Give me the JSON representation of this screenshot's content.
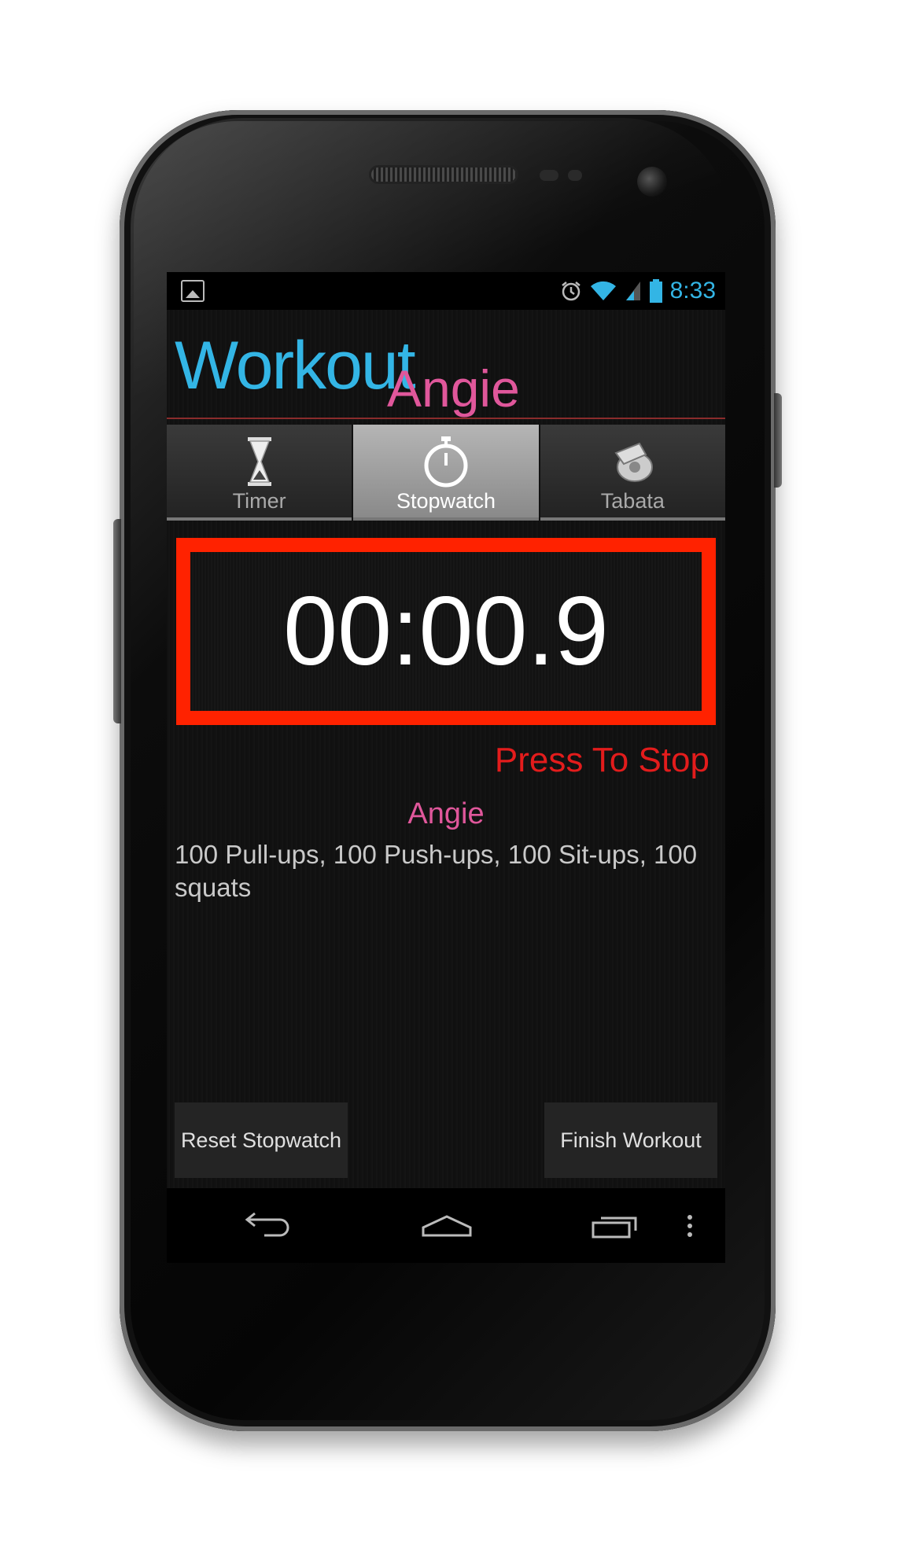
{
  "status_bar": {
    "time": "8:33",
    "left_icon": "picture-icon",
    "icons": [
      "alarm-icon",
      "wifi-icon",
      "signal-icon",
      "battery-icon"
    ]
  },
  "app_title": {
    "main": "Workout",
    "sub": "Angie"
  },
  "tabs": [
    {
      "label": "Timer",
      "icon": "hourglass-icon",
      "active": false
    },
    {
      "label": "Stopwatch",
      "icon": "stopwatch-icon",
      "active": true
    },
    {
      "label": "Tabata",
      "icon": "whistle-icon",
      "active": false
    }
  ],
  "stopwatch": {
    "display": "00:00.9",
    "action_text": "Press To Stop"
  },
  "workout": {
    "name": "Angie",
    "description": "100 Pull-ups, 100 Push-ups, 100 Sit-ups, 100 squats"
  },
  "buttons": {
    "reset": "Reset Stopwatch",
    "finish": "Finish Workout"
  },
  "nav": [
    "back-icon",
    "home-icon",
    "recent-apps-icon",
    "overflow-menu-icon"
  ],
  "colors": {
    "title_blue": "#33b5e5",
    "accent_pink": "#e0579b",
    "timer_border_red": "#ff2200",
    "stop_text_red": "#e31c1c"
  }
}
